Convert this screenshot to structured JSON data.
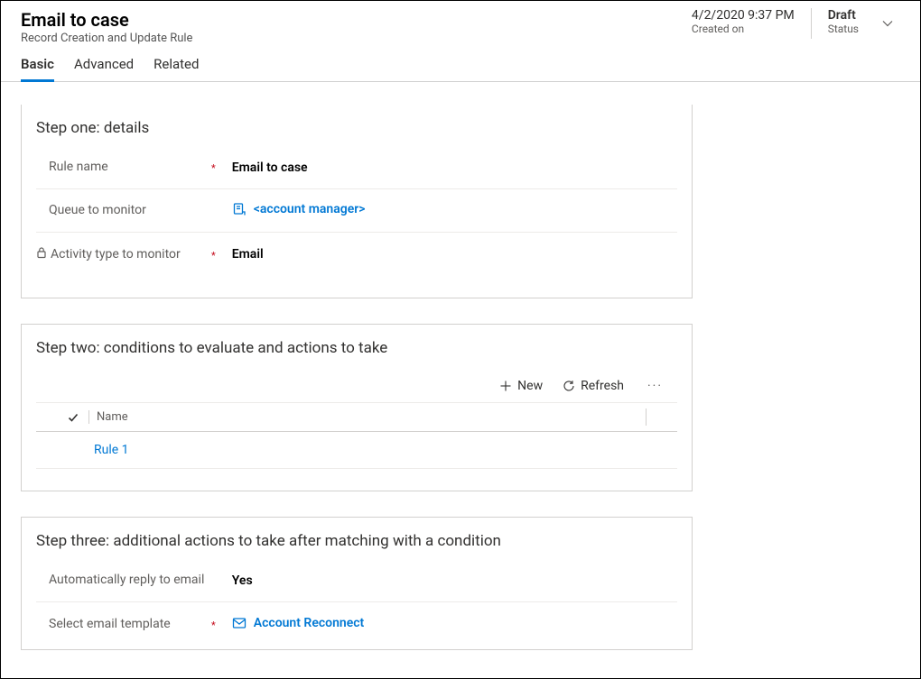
{
  "header": {
    "title": "Email to case",
    "subtitle": "Record Creation and Update Rule",
    "created_on_value": "4/2/2020 9:37 PM",
    "created_on_label": "Created on",
    "status_value": "Draft",
    "status_label": "Status"
  },
  "tabs": {
    "basic": "Basic",
    "advanced": "Advanced",
    "related": "Related"
  },
  "step1": {
    "title": "Step one: details",
    "rule_name_label": "Rule name",
    "rule_name_value": "Email to case",
    "queue_label": "Queue to monitor",
    "queue_value": "<account manager>",
    "activity_label": "Activity type to monitor",
    "activity_value": "Email"
  },
  "step2": {
    "title": "Step two: conditions to evaluate and actions to take",
    "new_label": "New",
    "refresh_label": "Refresh",
    "col_name": "Name",
    "row1_name": "Rule 1"
  },
  "step3": {
    "title": "Step three: additional actions to take after matching with a condition",
    "auto_reply_label": "Automatically reply to email",
    "auto_reply_value": "Yes",
    "template_label": "Select email template",
    "template_value": "Account Reconnect"
  }
}
